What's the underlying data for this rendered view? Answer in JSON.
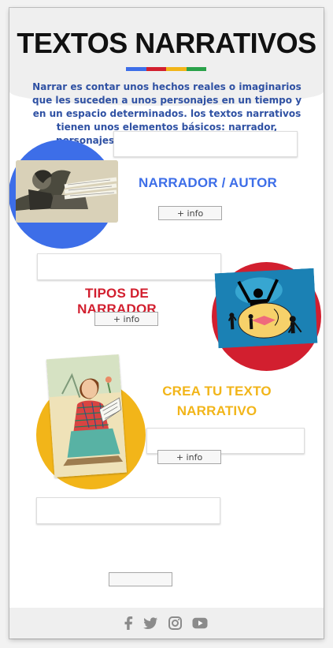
{
  "page": {
    "title": "TEXTOS NARRATIVOS",
    "intro": "Narrar es contar unos hechos reales o imaginarios que les suceden a unos personajes en un tiempo y en un espacio determinados. los textos narrativos tienen unos elementos básicos: narrador, personajes, estructura, espacio y tiempo.",
    "accent_colors": [
      "#3d6ee8",
      "#d21f2f",
      "#f2b519",
      "#2aa24a"
    ]
  },
  "sections": [
    {
      "title": "NARRADOR / AUTOR",
      "button": "+ info",
      "color": "#3d6ee8",
      "image_icon": "writer-illustration"
    },
    {
      "title": "TIPOS DE NARRADOR",
      "button": "+ info",
      "color": "#d21f2f",
      "image_icon": "narrator-types-illustration"
    },
    {
      "title": "CREA TU TEXTO NARRATIVO",
      "title_line1": "CREA TU TEXTO",
      "title_line2": "NARRATIVO",
      "button": "+ info",
      "color": "#f2b519",
      "image_icon": "writing-woman-illustration"
    }
  ],
  "footer": {
    "icons": [
      "facebook-icon",
      "twitter-icon",
      "instagram-icon",
      "youtube-icon"
    ]
  }
}
